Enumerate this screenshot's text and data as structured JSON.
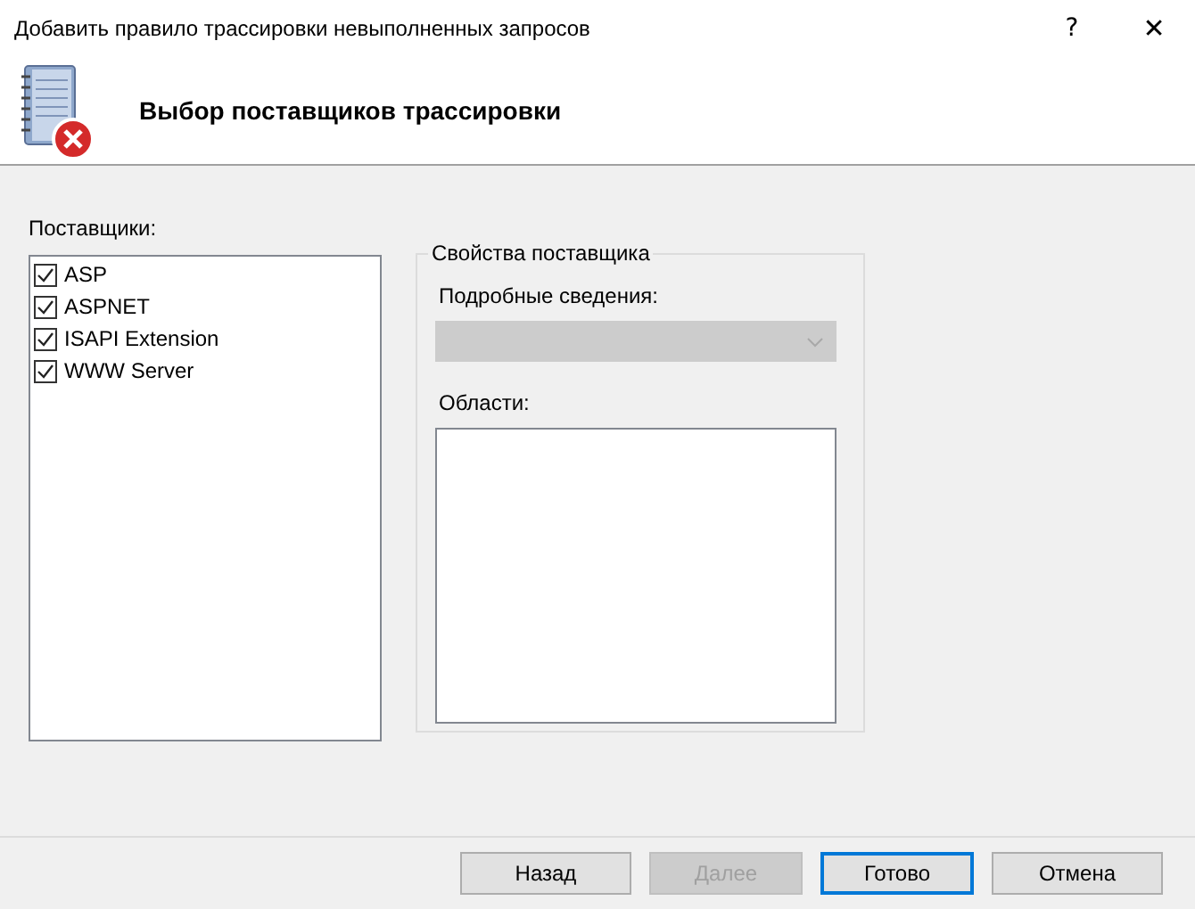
{
  "window": {
    "title": "Добавить правило трассировки невыполненных запросов",
    "help": "?",
    "close": "✕"
  },
  "header": {
    "title": "Выбор поставщиков трассировки"
  },
  "providers": {
    "label": "Поставщики:",
    "items": [
      {
        "label": "ASP",
        "checked": true
      },
      {
        "label": "ASPNET",
        "checked": true
      },
      {
        "label": "ISAPI Extension",
        "checked": true
      },
      {
        "label": "WWW Server",
        "checked": true
      }
    ]
  },
  "properties": {
    "legend": "Свойства поставщика",
    "details_label": "Подробные сведения:",
    "details_disabled": true,
    "areas_label": "Области:"
  },
  "buttons": [
    {
      "label": "Назад",
      "disabled": false,
      "default": false
    },
    {
      "label": "Далее",
      "disabled": true,
      "default": false
    },
    {
      "label": "Готово",
      "disabled": false,
      "default": true
    },
    {
      "label": "Отмена",
      "disabled": false,
      "default": false
    }
  ]
}
